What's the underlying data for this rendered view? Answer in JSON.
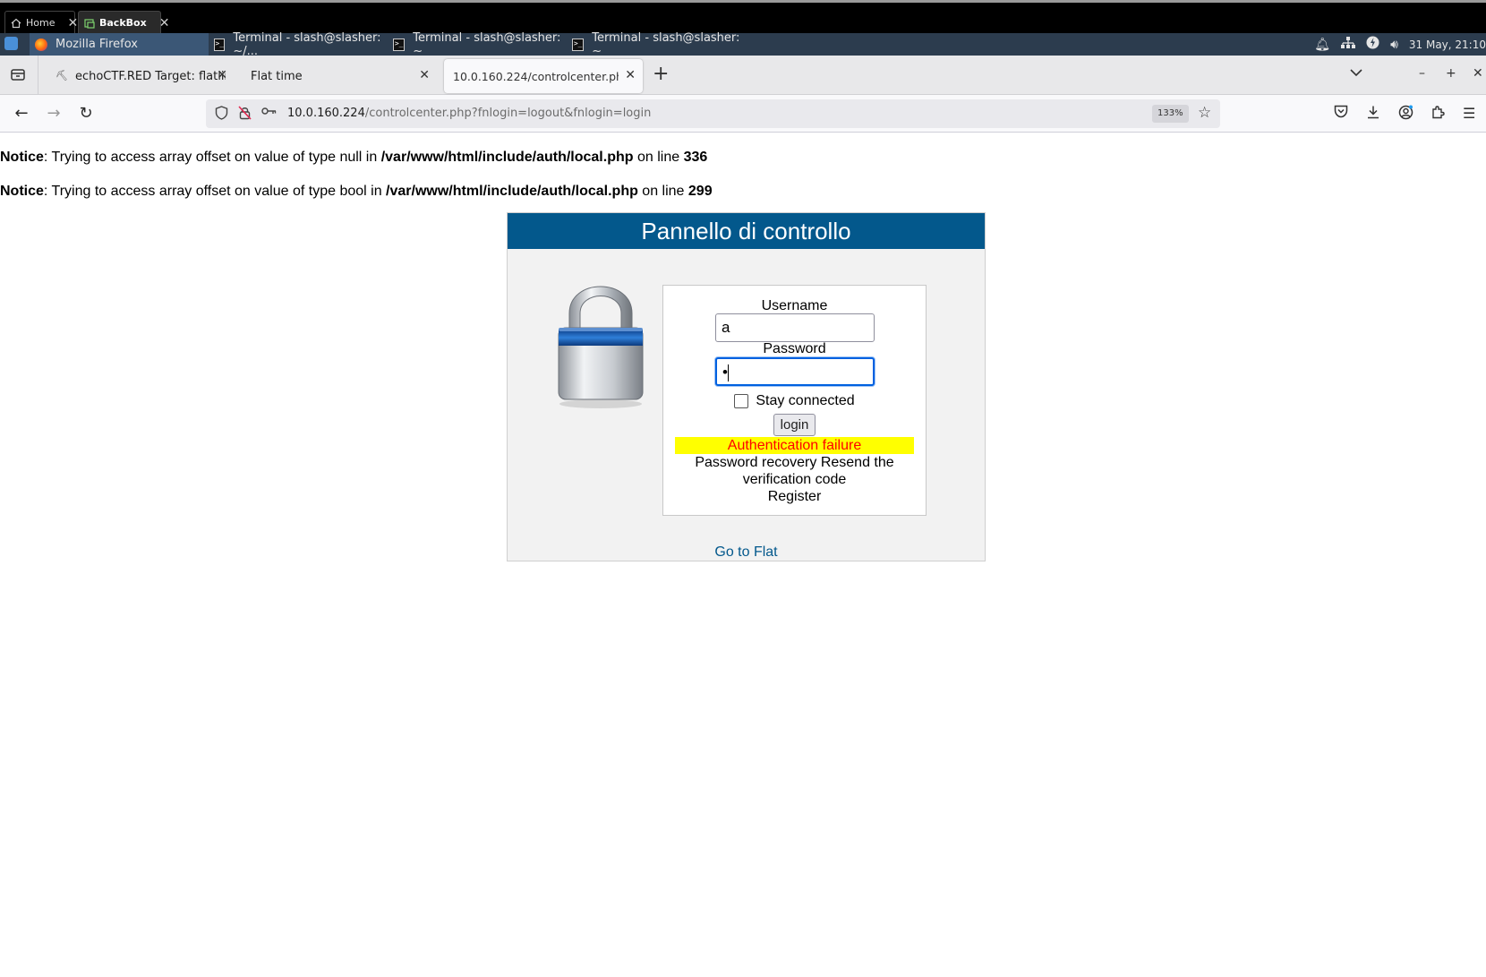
{
  "vm_tabs": [
    {
      "label": "Home",
      "active": false
    },
    {
      "label": "BackBox",
      "active": true
    }
  ],
  "taskbar": {
    "tasks": [
      {
        "label": "Mozilla Firefox",
        "icon": "firefox-icon",
        "active": true
      },
      {
        "label": "Terminal - slash@slasher: ~/...",
        "icon": "terminal-icon",
        "active": false
      },
      {
        "label": "Terminal - slash@slasher: ~",
        "icon": "terminal-icon",
        "active": false
      },
      {
        "label": "Terminal - slash@slasher: ~",
        "icon": "terminal-icon",
        "active": false
      }
    ],
    "clock": "31 May, 21:10"
  },
  "browser": {
    "tabs": [
      {
        "label": "echoCTF.RED Target: flatliner",
        "active": false
      },
      {
        "label": "Flat time",
        "active": false
      },
      {
        "label": "10.0.160.224/controlcenter.php?fnlogin=logout&fnlogin=login",
        "active": true
      }
    ],
    "url_host": "10.0.160.224",
    "url_path": "/controlcenter.php?fnlogin=logout&fnlogin=login",
    "zoom": "133%"
  },
  "page": {
    "notices": [
      {
        "prefix": "Notice",
        "text": ": Trying to access array offset on value of type null in ",
        "file": "/var/www/html/include/auth/local.php",
        "on_line": " on line ",
        "line": "336"
      },
      {
        "prefix": "Notice",
        "text": ": Trying to access array offset on value of type bool in ",
        "file": "/var/www/html/include/auth/local.php",
        "on_line": " on line ",
        "line": "299"
      }
    ],
    "panel_title": "Pannello di controllo",
    "username_label": "Username",
    "username_value": "a",
    "password_label": "Password",
    "password_value": "•",
    "stay_connected": "Stay connected",
    "login_button": "login",
    "error": "Authentication failure",
    "links_line1": "Password recovery Resend the",
    "links_line2": "verification code",
    "register": "Register",
    "goto": "Go to Flat"
  },
  "colors": {
    "header_blue": "#03588c",
    "error_bg": "#ffff00",
    "error_text": "#ff0000"
  }
}
